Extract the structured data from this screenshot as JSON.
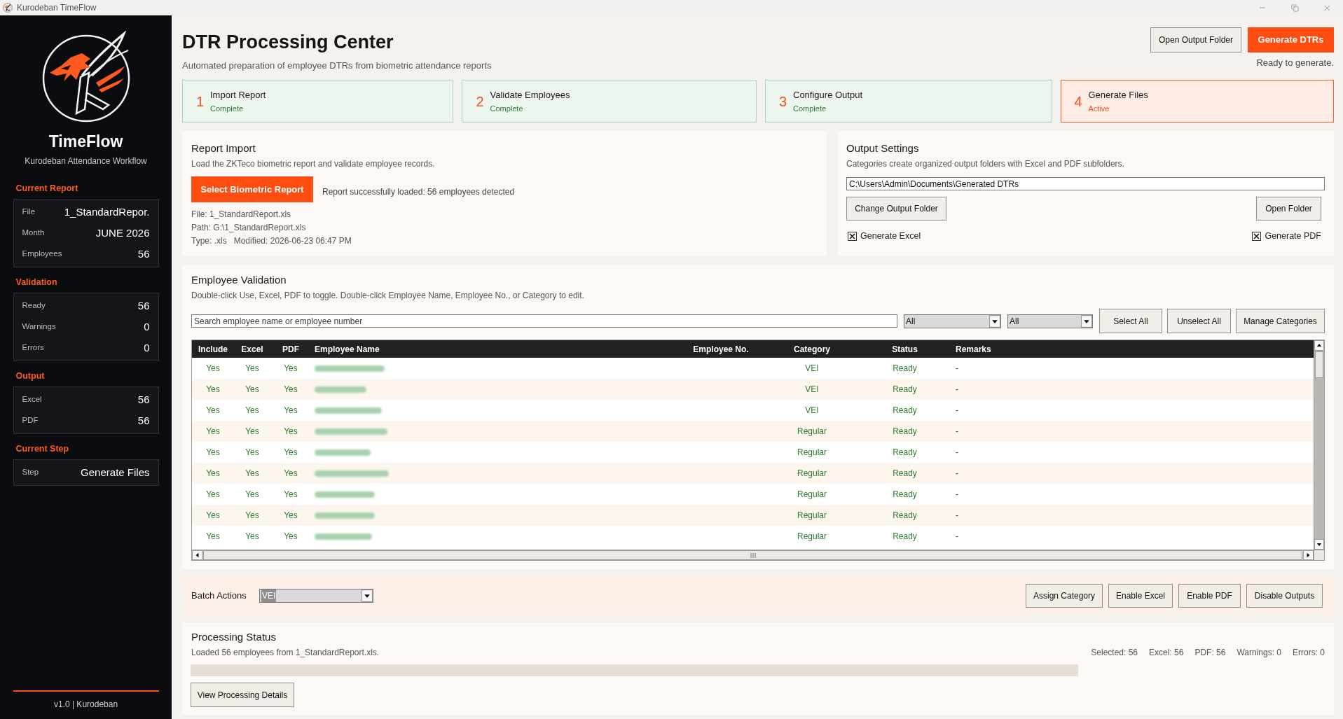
{
  "window": {
    "title": "Kurodeban TimeFlow"
  },
  "sidebar": {
    "app_name": "TimeFlow",
    "tagline": "Kurodeban Attendance Workflow",
    "sections": [
      {
        "title": "Current Report",
        "rows": [
          {
            "label": "File",
            "value": "1_StandardRepor."
          },
          {
            "label": "Month",
            "value": "JUNE 2026"
          },
          {
            "label": "Employees",
            "value": "56"
          }
        ]
      },
      {
        "title": "Validation",
        "rows": [
          {
            "label": "Ready",
            "value": "56"
          },
          {
            "label": "Warnings",
            "value": "0"
          },
          {
            "label": "Errors",
            "value": "0"
          }
        ]
      },
      {
        "title": "Output",
        "rows": [
          {
            "label": "Excel",
            "value": "56"
          },
          {
            "label": "PDF",
            "value": "56"
          }
        ]
      },
      {
        "title": "Current Step",
        "rows": [
          {
            "label": "Step",
            "value": "Generate Files"
          }
        ]
      }
    ],
    "footer": "v1.0 | Kurodeban"
  },
  "header": {
    "title": "DTR Processing Center",
    "subtitle": "Automated preparation of employee DTRs from biometric attendance reports",
    "buttons": [
      {
        "label": "Open Output Folder",
        "kind": "secondary"
      },
      {
        "label": "Generate DTRs",
        "kind": "primary"
      }
    ],
    "status": "Ready to generate."
  },
  "steps": [
    {
      "number": "1",
      "label": "Import Report",
      "status": "Complete",
      "selected": false
    },
    {
      "number": "2",
      "label": "Validate Employees",
      "status": "Complete",
      "selected": false
    },
    {
      "number": "3",
      "label": "Configure Output",
      "status": "Complete",
      "selected": false
    },
    {
      "number": "4",
      "label": "Generate Files",
      "status": "Active",
      "selected": true
    }
  ],
  "report_import": {
    "title": "Report Import",
    "description": "Load the ZKTeco biometric report and validate employee records.",
    "button": {
      "label": "Select Biometric Report",
      "kind": "primary"
    },
    "message": "Report successfully loaded: 56 employees detected",
    "details": [
      [
        "File: 1_StandardReport.xls"
      ],
      [
        "Path: G:\\1_StandardReport.xls"
      ],
      [
        "Type: .xls",
        "Modified: 2026-06-23 06:47 PM"
      ]
    ]
  },
  "output_settings": {
    "title": "Output Settings",
    "description": "Categories create organized output folders with Excel and PDF subfolders.",
    "folder_path": "C:\\Users\\Admin\\Documents\\Generated DTRs",
    "buttons": [
      "Change Output Folder",
      "Open Folder"
    ],
    "checkboxes": [
      {
        "label": "Generate Excel",
        "checked": true
      },
      {
        "label": "Generate PDF",
        "checked": true
      }
    ]
  },
  "employee_validation": {
    "title": "Employee Validation",
    "description": "Double-click Use, Excel, PDF to toggle. Double-click Employee Name, Employee No., or Category to edit.",
    "search": {
      "placeholder": "Search employee name or employee number"
    },
    "filters": [
      {
        "value": "All"
      },
      {
        "value": "All"
      }
    ],
    "buttons": [
      "Select All",
      "Unselect All",
      "Manage Categories"
    ],
    "table": {
      "columns": [
        "Include",
        "Excel",
        "PDF",
        "Employee Name",
        "Employee No.",
        "Category",
        "Status",
        "Remarks"
      ],
      "rows": [
        {
          "include": "Yes",
          "excel": "Yes",
          "pdf": "Yes",
          "employee_name_blurred": true,
          "category": "VEI",
          "status": "Ready",
          "remarks": "-"
        },
        {
          "include": "Yes",
          "excel": "Yes",
          "pdf": "Yes",
          "employee_name_blurred": true,
          "category": "VEI",
          "status": "Ready",
          "remarks": "-"
        },
        {
          "include": "Yes",
          "excel": "Yes",
          "pdf": "Yes",
          "employee_name_blurred": true,
          "category": "VEI",
          "status": "Ready",
          "remarks": "-"
        },
        {
          "include": "Yes",
          "excel": "Yes",
          "pdf": "Yes",
          "employee_name_blurred": true,
          "category": "Regular",
          "status": "Ready",
          "remarks": "-"
        },
        {
          "include": "Yes",
          "excel": "Yes",
          "pdf": "Yes",
          "employee_name_blurred": true,
          "category": "Regular",
          "status": "Ready",
          "remarks": "-"
        },
        {
          "include": "Yes",
          "excel": "Yes",
          "pdf": "Yes",
          "employee_name_blurred": true,
          "category": "Regular",
          "status": "Ready",
          "remarks": "-"
        },
        {
          "include": "Yes",
          "excel": "Yes",
          "pdf": "Yes",
          "employee_name_blurred": true,
          "category": "Regular",
          "status": "Ready",
          "remarks": "-"
        },
        {
          "include": "Yes",
          "excel": "Yes",
          "pdf": "Yes",
          "employee_name_blurred": true,
          "category": "Regular",
          "status": "Ready",
          "remarks": "-"
        },
        {
          "include": "Yes",
          "excel": "Yes",
          "pdf": "Yes",
          "employee_name_blurred": true,
          "category": "Regular",
          "status": "Ready",
          "remarks": "-"
        }
      ]
    }
  },
  "batch_actions": {
    "label": "Batch Actions",
    "category_select": {
      "value": "VEI",
      "highlighted": true
    },
    "buttons": [
      "Assign Category",
      "Enable Excel",
      "Enable PDF",
      "Disable Outputs"
    ]
  },
  "processing_status": {
    "title": "Processing Status",
    "message": "Loaded 56 employees from 1_StandardReport.xls.",
    "stats": [
      "Selected: 56",
      "Excel: 56",
      "PDF: 56",
      "Warnings: 0",
      "Errors: 0"
    ],
    "progress": {
      "level": 0
    },
    "button": "View Processing Details"
  }
}
